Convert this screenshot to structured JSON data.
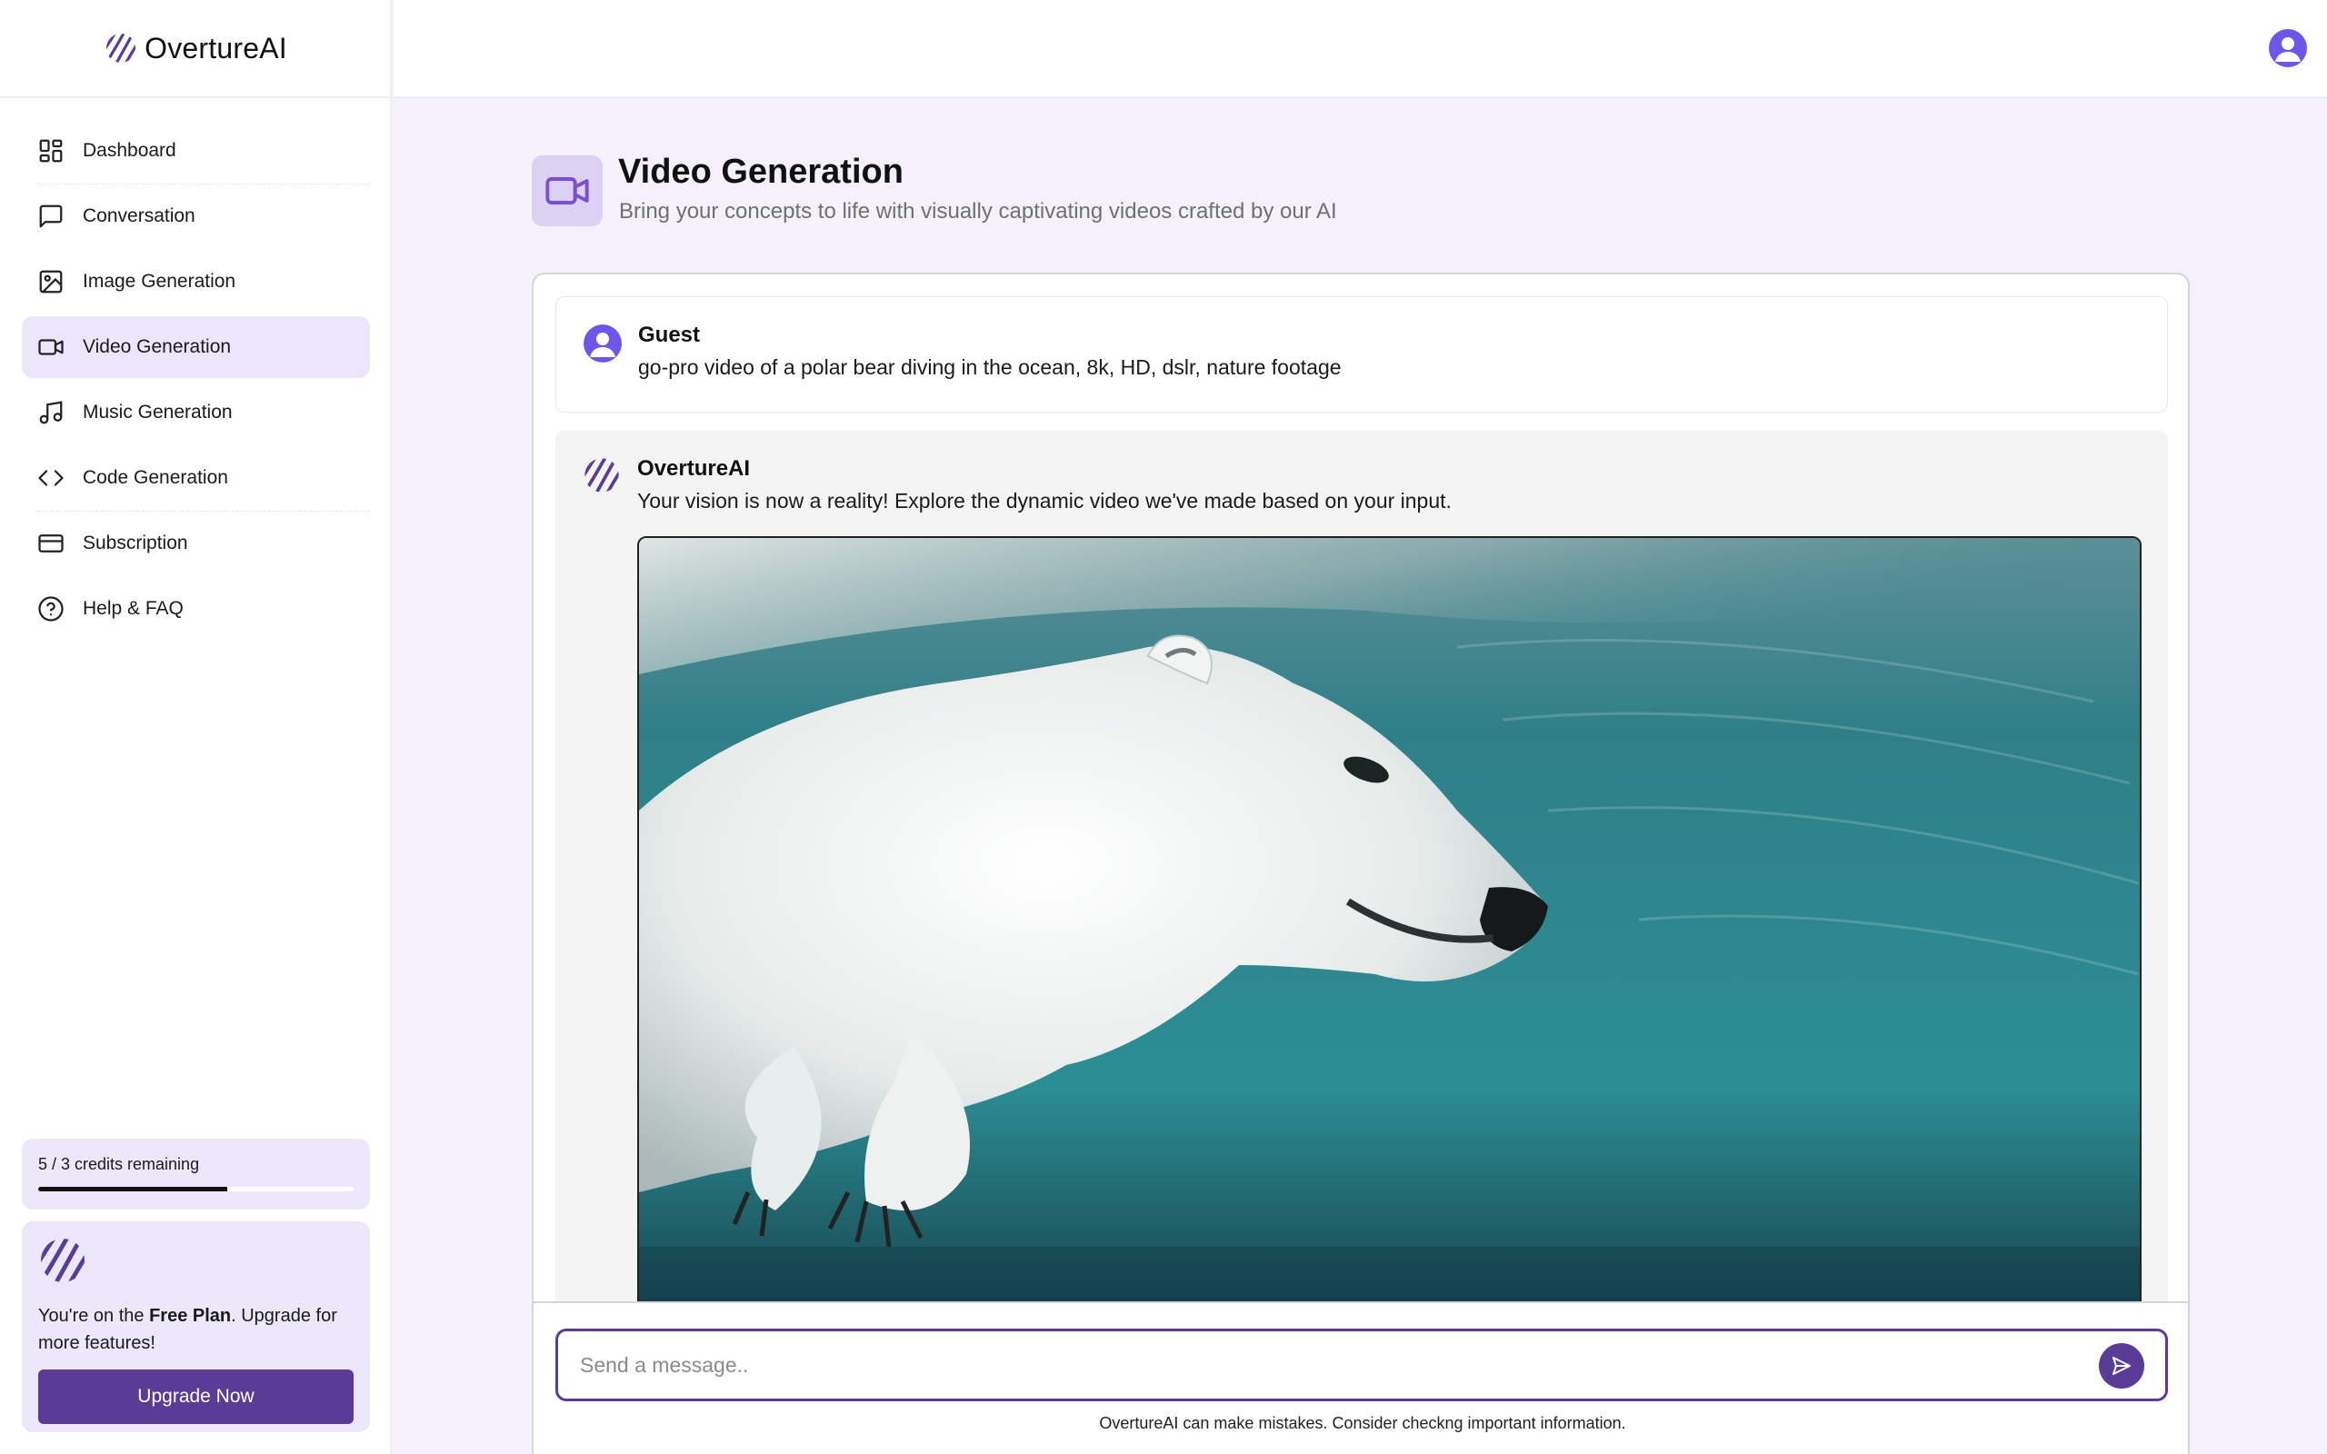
{
  "app": {
    "name": "OvertureAI"
  },
  "sidebar": {
    "items": [
      {
        "label": "Dashboard",
        "icon": "dashboard-icon"
      },
      {
        "label": "Conversation",
        "icon": "message-square-icon"
      },
      {
        "label": "Image Generation",
        "icon": "image-icon"
      },
      {
        "label": "Video Generation",
        "icon": "video-icon",
        "active": true
      },
      {
        "label": "Music Generation",
        "icon": "music-icon"
      },
      {
        "label": "Code Generation",
        "icon": "code-icon"
      },
      {
        "label": "Subscription",
        "icon": "credit-card-icon"
      },
      {
        "label": "Help & FAQ",
        "icon": "help-circle-icon"
      }
    ],
    "credits": {
      "text": "5 / 3 credits remaining",
      "progress_fraction": 0.6
    },
    "plan": {
      "prefix": "You're on the ",
      "plan_name": "Free Plan",
      "suffix": ". Upgrade for more features!",
      "button_label": "Upgrade Now"
    }
  },
  "header": {
    "title": "Video Generation",
    "subtitle": "Bring your concepts to life with visually captivating videos crafted by our AI"
  },
  "chat": {
    "messages": [
      {
        "author": "Guest",
        "text": "go-pro video of a polar bear diving in the ocean, 8k, HD, dslr, nature footage"
      },
      {
        "author": "OvertureAI",
        "text": "Your vision is now a reality! Explore the dynamic video we've made based on your input."
      }
    ],
    "composer": {
      "placeholder": "Send a message..",
      "disclaimer": "OvertureAI can make mistakes. Consider checkng important information."
    }
  },
  "colors": {
    "accent": "#5a3c96",
    "active_bg": "#ebe6fb",
    "page_bg": "#f4f1fd",
    "avatar": "#6e56e8"
  }
}
